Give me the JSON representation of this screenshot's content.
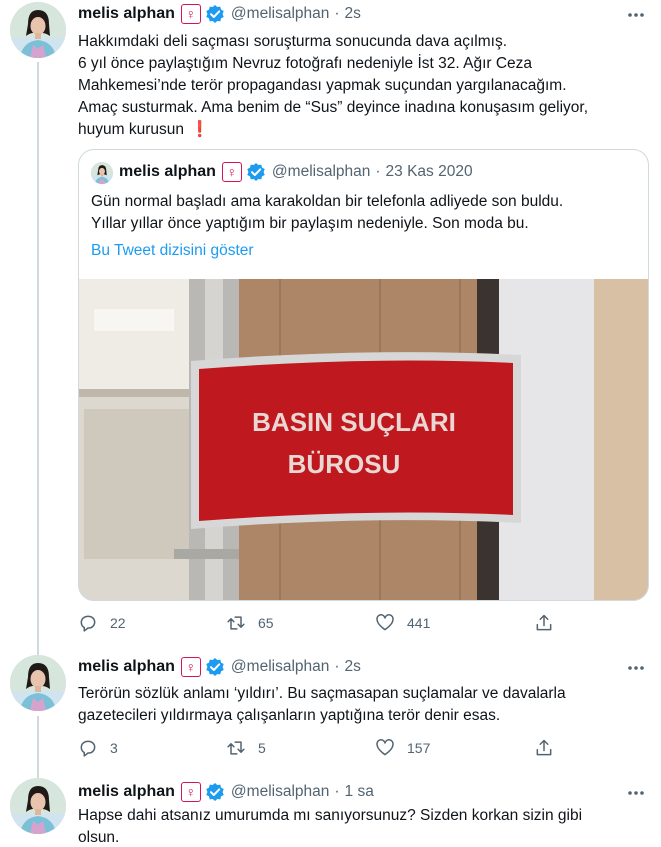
{
  "tweets": [
    {
      "name": "melis alphan",
      "badge": "♀",
      "handle": "@melisalphan",
      "time": "2s",
      "lines": [
        "Hakkımdaki deli saçması soruşturma sonucunda dava açılmış.",
        "6 yıl önce paylaştığım Nevruz fotoğrafı nedeniyle İst 32. Ağır Ceza",
        "Mahkemesi’nde terör propagandası yapmak suçundan yargılanacağım.",
        "Amaç susturmak. Ama benim de “Sus” deyince inadına konuşasım geliyor,",
        "huyum kurusun"
      ],
      "emoji": "❗",
      "quote": {
        "name": "melis alphan",
        "badge": "♀",
        "handle": "@melisalphan",
        "time": "23 Kas 2020",
        "lines": [
          "Gün normal başladı ama karakoldan bir telefonla adliyede son buldu.",
          "Yıllar yıllar önce yaptığım bir paylaşım nedeniyle. Son moda bu."
        ],
        "link": "Bu Tweet dizisini göster",
        "image_sign_lines": [
          "BASIN SUÇLARI",
          "BÜROSU"
        ]
      },
      "counts": {
        "replies": "22",
        "retweets": "65",
        "likes": "441"
      }
    },
    {
      "name": "melis alphan",
      "badge": "♀",
      "handle": "@melisalphan",
      "time": "2s",
      "lines": [
        "Terörün sözlük anlamı ‘yıldırı’. Bu saçmasapan suçlamalar ve davalarla",
        "gazetecileri yıldırmaya çalışanların yaptığına terör denir esas."
      ],
      "counts": {
        "replies": "3",
        "retweets": "5",
        "likes": "157"
      }
    },
    {
      "name": "melis alphan",
      "badge": "♀",
      "handle": "@melisalphan",
      "time": "1 sa",
      "lines": [
        "Hapse dahi atsanız umurumda mı sanıyorsunuz? Sizden korkan sizin gibi",
        "olsun."
      ]
    }
  ],
  "colors": {
    "accent": "#1d9bf0",
    "badge": "#d4145a",
    "muted": "#536471",
    "sign_red": "#c0181f"
  },
  "icons": {
    "more": "more-dots-icon",
    "verified": "verified-badge-icon",
    "reply": "reply-icon",
    "retweet": "retweet-icon",
    "like": "like-icon",
    "share": "share-icon"
  }
}
